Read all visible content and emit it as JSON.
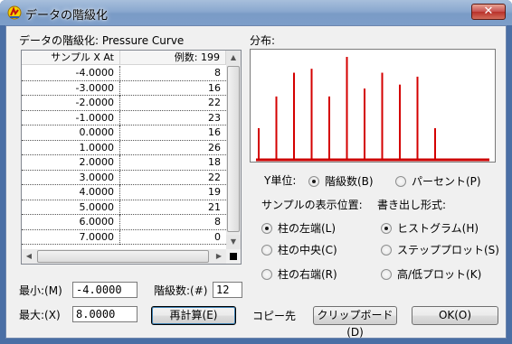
{
  "window": {
    "title": "データの階級化",
    "close_label": "✕"
  },
  "left_label": "データの階級化: Pressure Curve",
  "table": {
    "headers": [
      "サンプル X At",
      "例数: 199"
    ],
    "rows": [
      [
        "-4.0000",
        "8"
      ],
      [
        "-3.0000",
        "16"
      ],
      [
        "-2.0000",
        "22"
      ],
      [
        "-1.0000",
        "23"
      ],
      [
        "0.0000",
        "16"
      ],
      [
        "1.0000",
        "26"
      ],
      [
        "2.0000",
        "18"
      ],
      [
        "3.0000",
        "22"
      ],
      [
        "4.0000",
        "19"
      ],
      [
        "5.0000",
        "21"
      ],
      [
        "6.0000",
        "8"
      ],
      [
        "7.0000",
        "0"
      ]
    ]
  },
  "distribution_label": "分布:",
  "chart_data": {
    "type": "bar",
    "categories": [
      "-4.0000",
      "-3.0000",
      "-2.0000",
      "-1.0000",
      "0.0000",
      "1.0000",
      "2.0000",
      "3.0000",
      "4.0000",
      "5.0000",
      "6.0000",
      "7.0000"
    ],
    "values": [
      8,
      16,
      22,
      23,
      16,
      26,
      18,
      22,
      19,
      21,
      8,
      0
    ],
    "ylim": [
      0,
      26
    ],
    "bar_color": "#d40000",
    "baseline_color": "#cc0000"
  },
  "y_unit": {
    "label": "Y単位:",
    "options": [
      {
        "label": "階級数(B)",
        "selected": true
      },
      {
        "label": "パーセント(P)",
        "selected": false
      }
    ]
  },
  "sample_position": {
    "label": "サンプルの表示位置:",
    "options": [
      {
        "label": "柱の左端(L)",
        "selected": true
      },
      {
        "label": "柱の中央(C)",
        "selected": false
      },
      {
        "label": "柱の右端(R)",
        "selected": false
      }
    ]
  },
  "output_format": {
    "label": "書き出し形式:",
    "options": [
      {
        "label": "ヒストグラム(H)",
        "selected": true
      },
      {
        "label": "ステッププロット(S)",
        "selected": false
      },
      {
        "label": "高/低プロット(K)",
        "selected": false
      }
    ]
  },
  "min": {
    "label": "最小:(M)",
    "value": "-4.0000"
  },
  "max": {
    "label": "最大:(X)",
    "value": "8.0000"
  },
  "classes": {
    "label": "階級数:(#)",
    "value": "12"
  },
  "buttons": {
    "recalc": "再計算(E)",
    "copy_to": "コピー先",
    "clipboard": "クリップボード(D)",
    "ok": "OK(O)"
  }
}
